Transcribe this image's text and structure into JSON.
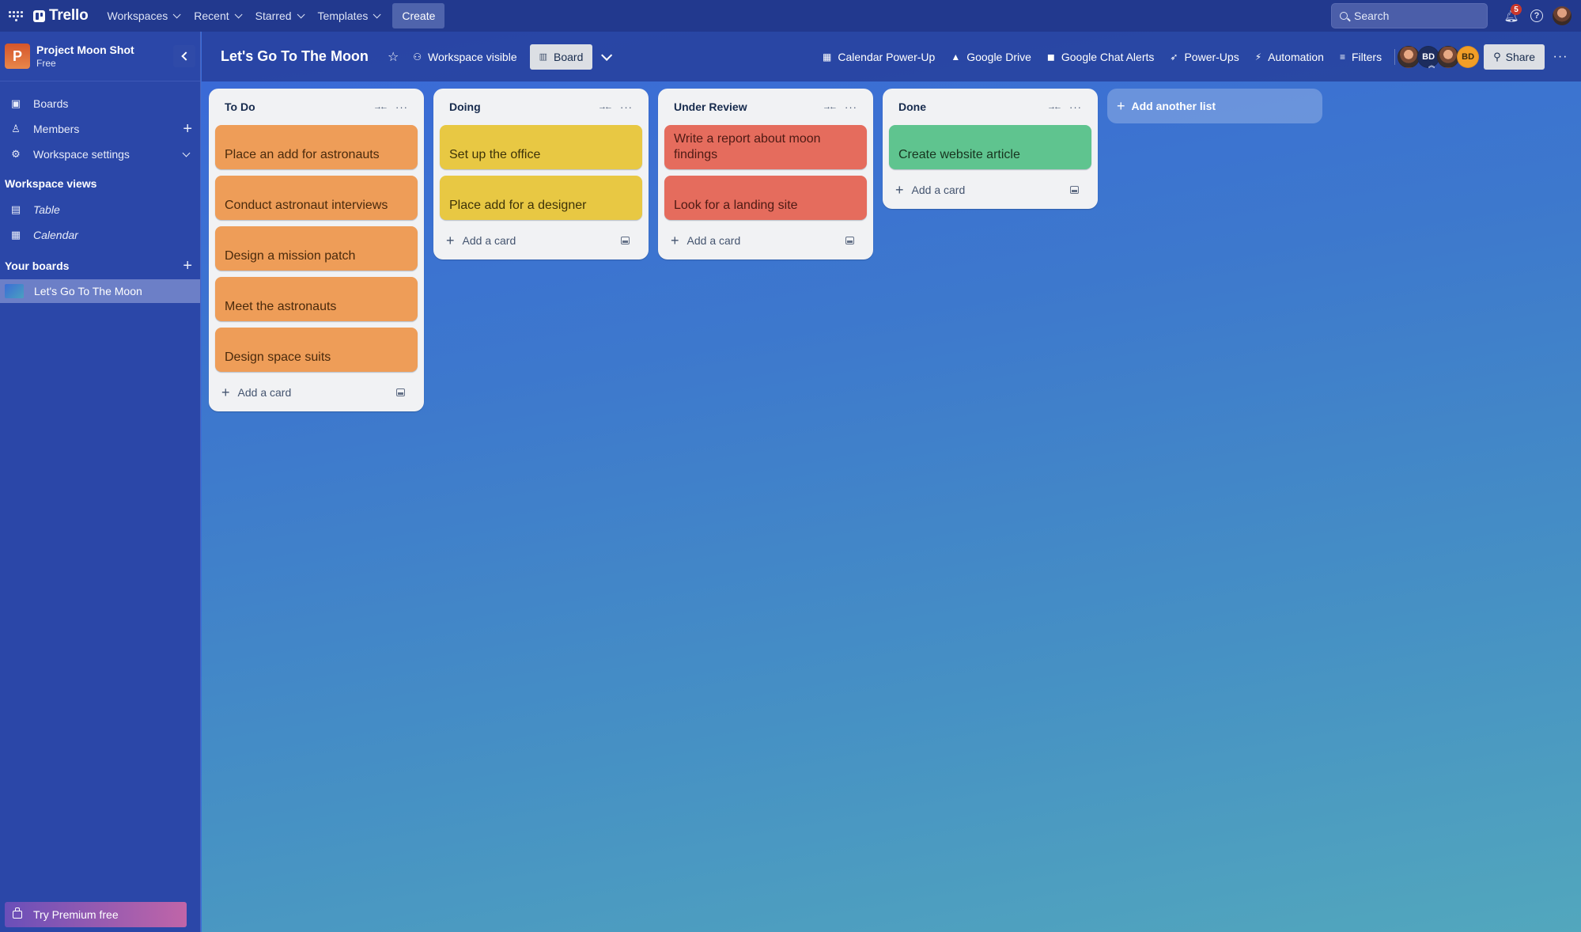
{
  "topnav": {
    "app_name": "Trello",
    "menus": [
      {
        "label": "Workspaces"
      },
      {
        "label": "Recent"
      },
      {
        "label": "Starred"
      },
      {
        "label": "Templates"
      }
    ],
    "create_label": "Create",
    "search_placeholder": "Search",
    "notifications_count": "5",
    "help_glyph": "?"
  },
  "sidebar": {
    "workspace_initial": "P",
    "workspace_name": "Project Moon Shot",
    "workspace_plan": "Free",
    "items": [
      {
        "label": "Boards",
        "icon": "board-icon"
      },
      {
        "label": "Members",
        "icon": "person-icon"
      },
      {
        "label": "Workspace settings",
        "icon": "gear-icon"
      }
    ],
    "views_heading": "Workspace views",
    "views": [
      {
        "label": "Table",
        "icon": "table-icon"
      },
      {
        "label": "Calendar",
        "icon": "calendar-icon"
      }
    ],
    "your_boards_heading": "Your boards",
    "boards": [
      {
        "label": "Let's Go To The Moon",
        "active": true
      }
    ],
    "premium_label": "Try Premium free"
  },
  "board_header": {
    "title": "Let's Go To The Moon",
    "visibility_label": "Workspace visible",
    "view_label": "Board",
    "powerups": [
      {
        "label": "Calendar Power-Up",
        "icon": "calendar-icon"
      },
      {
        "label": "Google Drive",
        "icon": "google-drive-icon"
      },
      {
        "label": "Google Chat Alerts",
        "icon": "chat-icon"
      },
      {
        "label": "Power-Ups",
        "icon": "rocket-icon"
      },
      {
        "label": "Automation",
        "icon": "lightning-icon"
      },
      {
        "label": "Filters",
        "icon": "filter-icon"
      }
    ],
    "members": [
      {
        "type": "photo",
        "initials": ""
      },
      {
        "type": "initials",
        "initials": "BD",
        "color": "#1d2d5e",
        "admin": true
      },
      {
        "type": "photo",
        "initials": ""
      },
      {
        "type": "initials",
        "initials": "BD",
        "color": "#f29e27"
      }
    ],
    "share_label": "Share"
  },
  "lists": [
    {
      "title": "To Do",
      "color": "#ee9d58",
      "cards": [
        "Place an add for astronauts",
        "Conduct astronaut interviews",
        "Design a mission patch",
        "Meet the astronauts",
        "Design space suits"
      ],
      "add_card_label": "Add a card"
    },
    {
      "title": "Doing",
      "color": "#e8c843",
      "cards": [
        "Set up the office",
        "Place add for a designer"
      ],
      "add_card_label": "Add a card"
    },
    {
      "title": "Under Review",
      "color": "#e56c5d",
      "cards": [
        "Write a report about moon findings",
        "Look for a landing site"
      ],
      "add_card_label": "Add a card"
    },
    {
      "title": "Done",
      "color": "#5fc48f",
      "cards": [
        "Create website article"
      ],
      "add_card_label": "Add a card"
    }
  ],
  "add_list_label": "Add another list"
}
